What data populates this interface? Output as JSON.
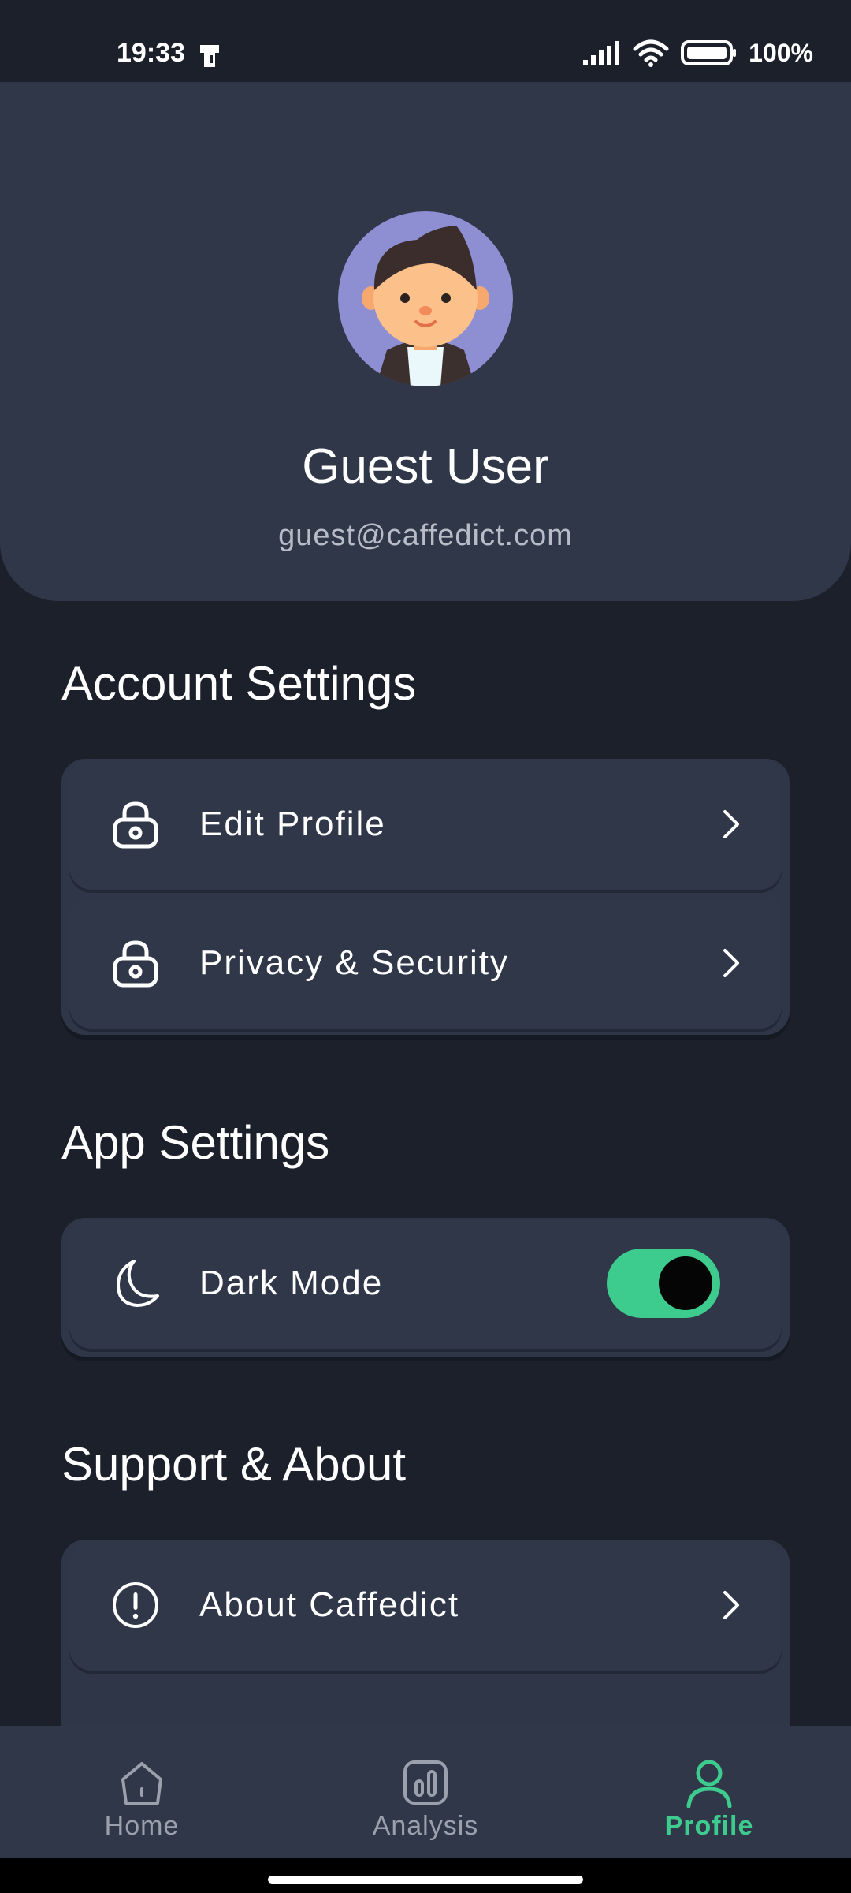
{
  "status_bar": {
    "time": "19:33",
    "battery_pct": "100%"
  },
  "profile": {
    "name": "Guest User",
    "email": "guest@caffedict.com"
  },
  "sections": {
    "account": {
      "title": "Account Settings",
      "items": [
        {
          "label": "Edit Profile",
          "icon": "lock-icon"
        },
        {
          "label": "Privacy & Security",
          "icon": "lock-icon"
        }
      ]
    },
    "app": {
      "title": "App Settings",
      "dark_mode": {
        "label": "Dark Mode",
        "icon": "moon-icon",
        "enabled": true
      }
    },
    "support": {
      "title": "Support & About",
      "items": [
        {
          "label": "About Caffedict",
          "icon": "info-icon"
        }
      ]
    }
  },
  "nav": {
    "items": [
      {
        "label": "Home",
        "icon": "home-icon",
        "active": false
      },
      {
        "label": "Analysis",
        "icon": "chart-icon",
        "active": false
      },
      {
        "label": "Profile",
        "icon": "user-icon",
        "active": true
      }
    ]
  },
  "colors": {
    "background": "#1c202b",
    "card": "#2f3749",
    "accent": "#3ecb8e",
    "muted": "#9aa1ad"
  }
}
